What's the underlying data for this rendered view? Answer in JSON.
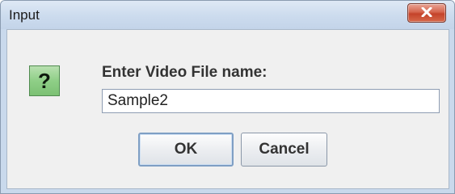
{
  "window": {
    "title": "Input"
  },
  "titlebar": {
    "close_icon": "close-x-icon"
  },
  "dialog": {
    "icon": "question-icon",
    "icon_glyph": "?",
    "prompt": "Enter Video File name:",
    "input_value": "Sample2"
  },
  "buttons": {
    "ok_label": "OK",
    "cancel_label": "Cancel"
  },
  "colors": {
    "close_button": "#d5654e",
    "question_icon": "#8fcf87",
    "titlebar": "#cddcee"
  }
}
